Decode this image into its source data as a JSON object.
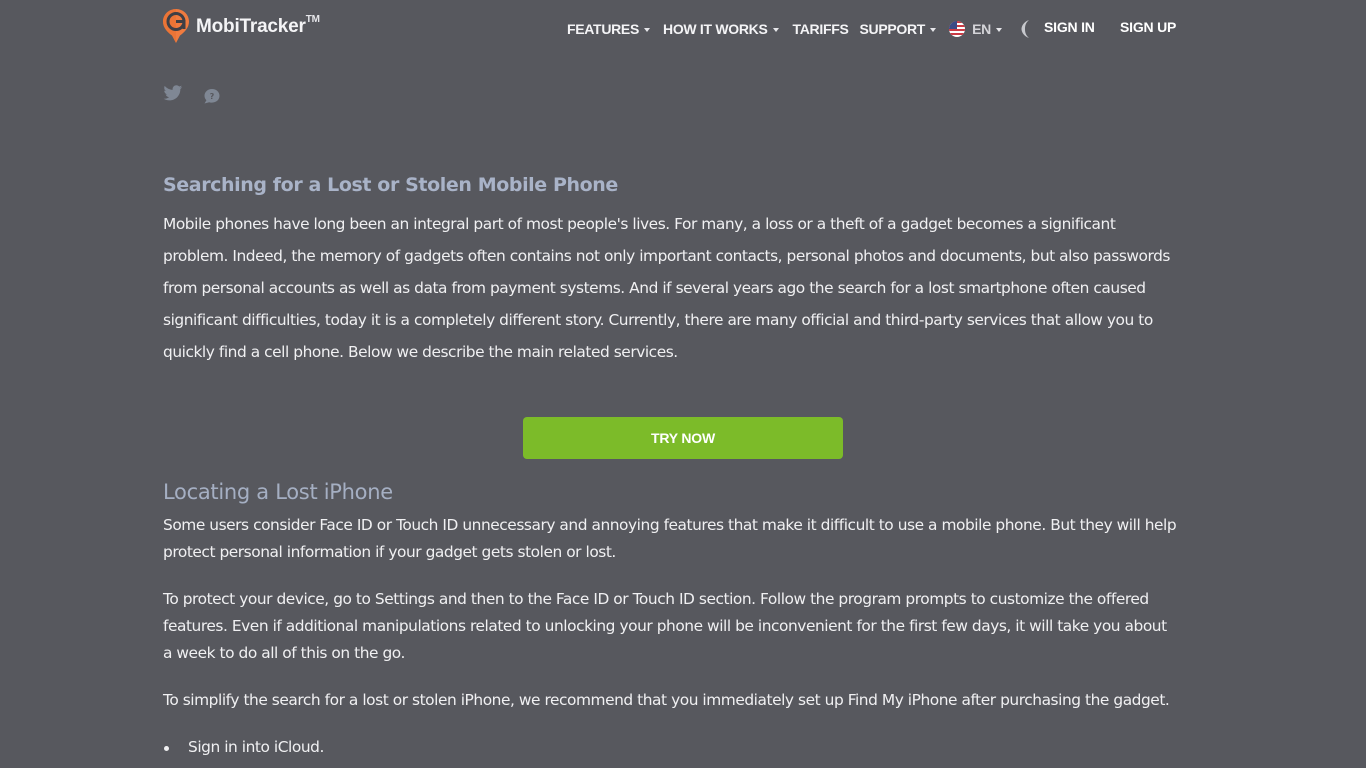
{
  "header": {
    "brand_name": "MobiTracker",
    "brand_tm": "TM",
    "brand_color": "#f07b3f",
    "nav": [
      {
        "label": "FEATURES",
        "has_dropdown": true
      },
      {
        "label": "HOW IT WORKS",
        "has_dropdown": true
      },
      {
        "label": "TARIFFS",
        "has_dropdown": false
      },
      {
        "label": "SUPPORT",
        "has_dropdown": true
      }
    ],
    "language": {
      "label": "EN",
      "flag": "us-flag-icon"
    },
    "theme_toggle_icon": "moon-icon",
    "sign_in_label": "SIGN IN",
    "sign_up_label": "SIGN UP"
  },
  "social": [
    {
      "icon": "twitter-icon"
    },
    {
      "icon": "help-chat-icon"
    }
  ],
  "article": {
    "section1": {
      "title": "Searching for a Lost or Stolen Mobile Phone",
      "lines": [
        "Mobile phones have long been an integral part of most people's lives. For many, a loss or a theft of a gadget becomes a significant",
        "problem. Indeed, the memory of gadgets often contains not only important contacts, personal photos and documents, but also passwords",
        "from personal accounts as well as data from payment systems. And if several years ago the search for a lost smartphone often caused",
        "significant difficulties, today it is a completely different story. Currently, there are many official and third-party services that allow you to",
        "quickly find a cell phone. Below we describe the main related services."
      ]
    },
    "cta": {
      "label": "TRY NOW",
      "color": "#7cbb29"
    },
    "section2": {
      "title": "Locating a Lost iPhone",
      "paragraphs": [
        {
          "lines": [
            "Some users consider Face ID or Touch ID unnecessary and annoying features that make it difficult to use a mobile phone. But they will help",
            "protect personal information if your gadget gets stolen or lost."
          ]
        },
        {
          "lines": [
            "To protect your device, go to Settings and then to the Face ID or Touch ID section. Follow the program prompts to customize the offered",
            "features. Even if additional manipulations related to unlocking your phone will be inconvenient for the first few days, it will take you about",
            "a week to do all of this on the go."
          ]
        },
        {
          "lines": [
            "To simplify the search for a lost or stolen iPhone, we recommend that you immediately set up Find My iPhone after purchasing the gadget."
          ]
        }
      ],
      "list": [
        "Sign in into iCloud."
      ]
    }
  }
}
